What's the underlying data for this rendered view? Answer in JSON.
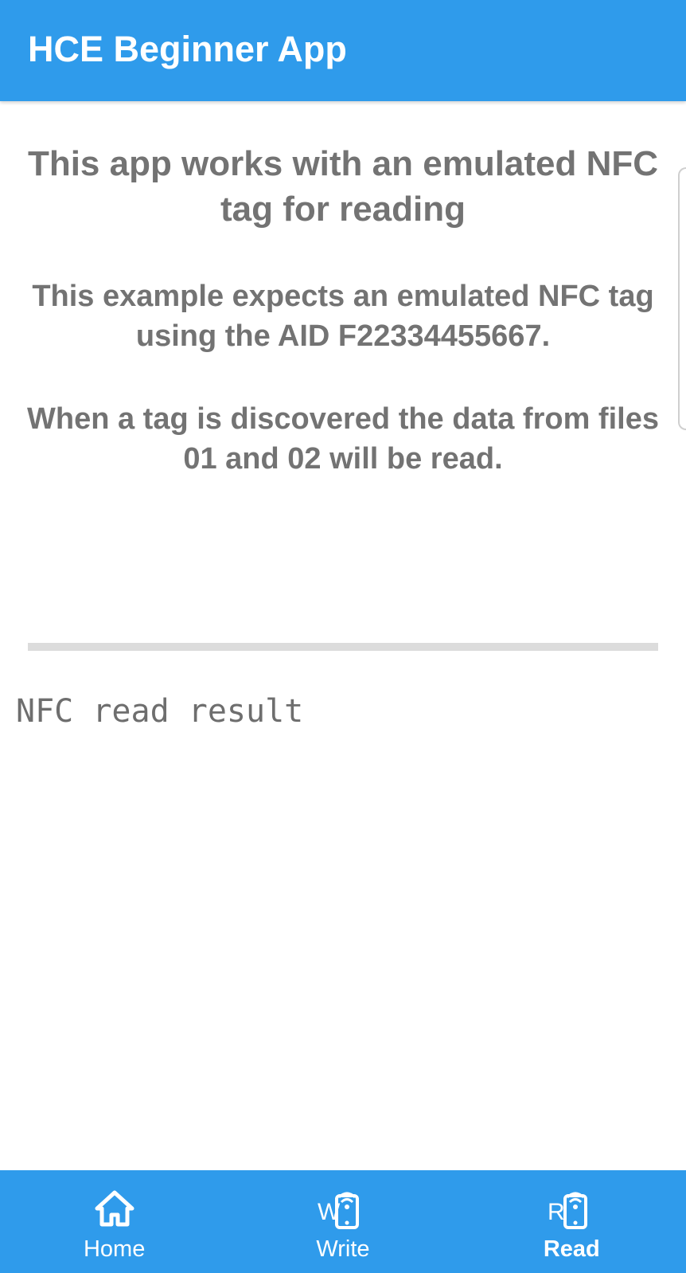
{
  "app_bar": {
    "title": "HCE Beginner App"
  },
  "content": {
    "heading": "This app works with an emulated NFC tag for reading",
    "paragraph_aid": "This example expects an emulated NFC tag using the AID F22334455667.",
    "paragraph_files": "When a tag is discovered the data from files 01 and 02 will be read.",
    "result_text": "NFC read result"
  },
  "bottom_nav": {
    "items": [
      {
        "label": "Home",
        "icon": "home-icon",
        "active": false
      },
      {
        "label": "Write",
        "icon": "nfc-write-icon",
        "icon_letter": "W",
        "active": false
      },
      {
        "label": "Read",
        "icon": "nfc-read-icon",
        "icon_letter": "R",
        "active": true
      }
    ]
  },
  "colors": {
    "primary": "#2f9beb",
    "text_gray": "#737373",
    "divider": "#dcdcdc",
    "on_primary": "#ffffff"
  }
}
